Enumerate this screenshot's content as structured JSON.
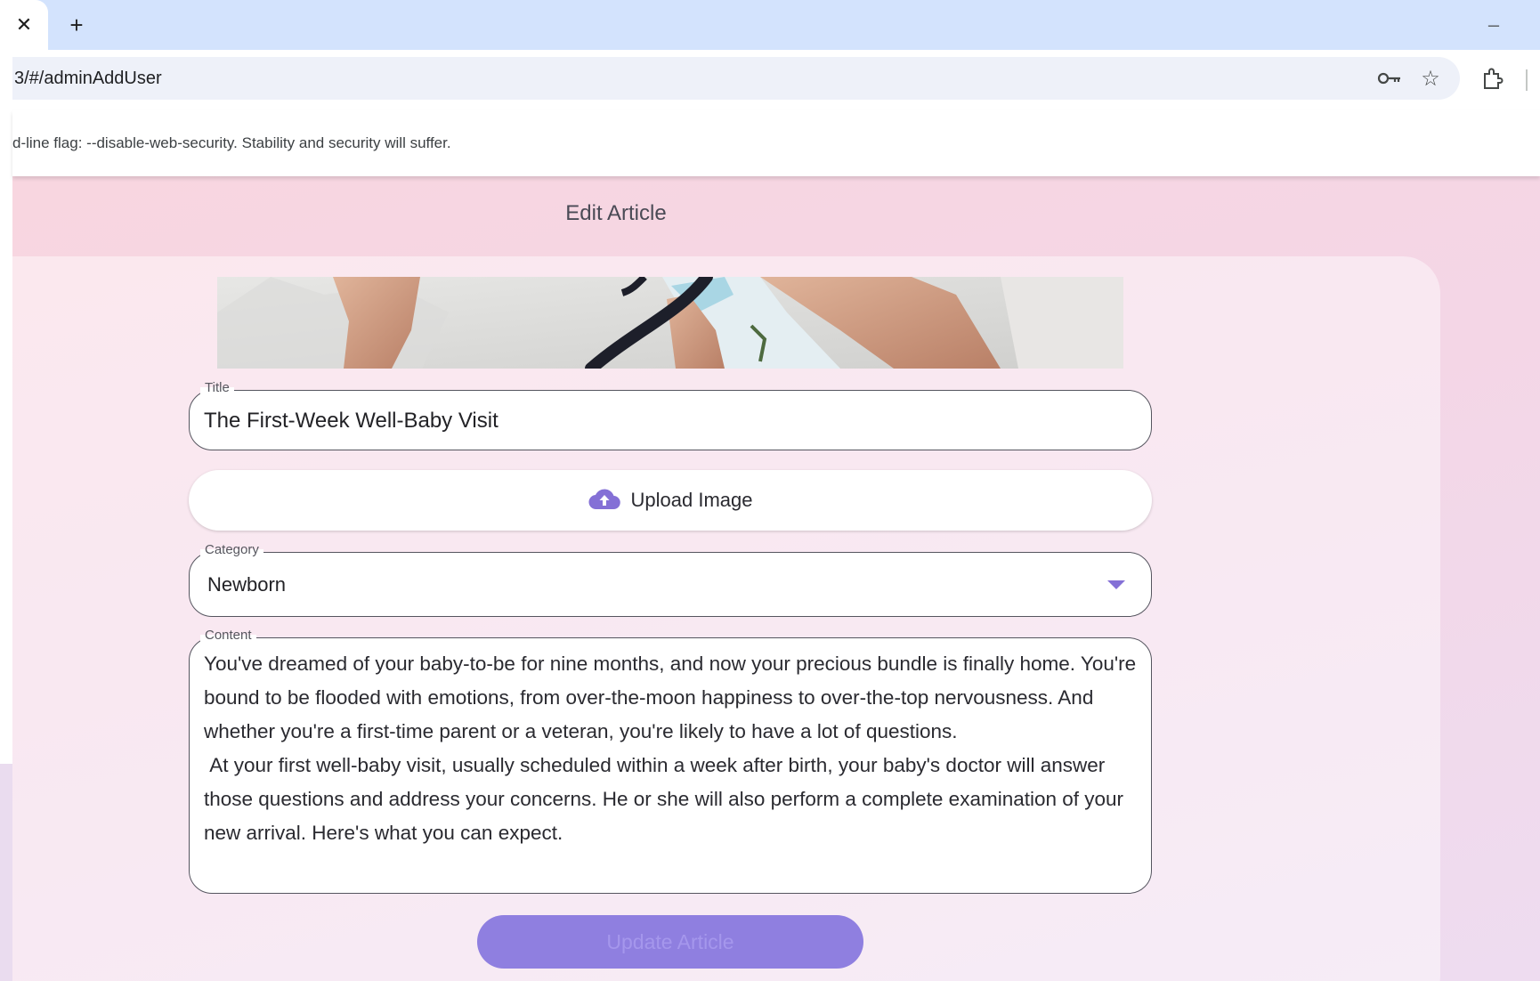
{
  "browser": {
    "close_glyph": "✕",
    "new_tab_glyph": "+",
    "minimize_glyph": "–",
    "url": "3/#/adminAddUser",
    "infobar_message": "d-line flag: --disable-web-security. Stability and security will suffer."
  },
  "page": {
    "title": "Edit Article"
  },
  "form": {
    "title_label": "Title",
    "title_value": "The First-Week Well-Baby Visit",
    "upload_label": "Upload Image",
    "category_label": "Category",
    "category_value": "Newborn",
    "content_label": "Content",
    "content_value": "You've dreamed of your baby-to-be for nine months, and now your precious bundle is finally home. You're bound to be flooded with emotions, from over-the-moon happiness to over-the-top nervousness. And whether you're a first-time parent or a veteran, you're likely to have a lot of questions.\n At your first well-baby visit, usually scheduled within a week after birth, your baby's doctor will answer those questions and address your concerns. He or she will also perform a complete examination of your new arrival. Here's what you can expect.",
    "submit_label": "Update Article"
  },
  "colors": {
    "accent": "#8470d6",
    "button": "#8f7fe0",
    "tabstrip": "#d3e3fd"
  }
}
